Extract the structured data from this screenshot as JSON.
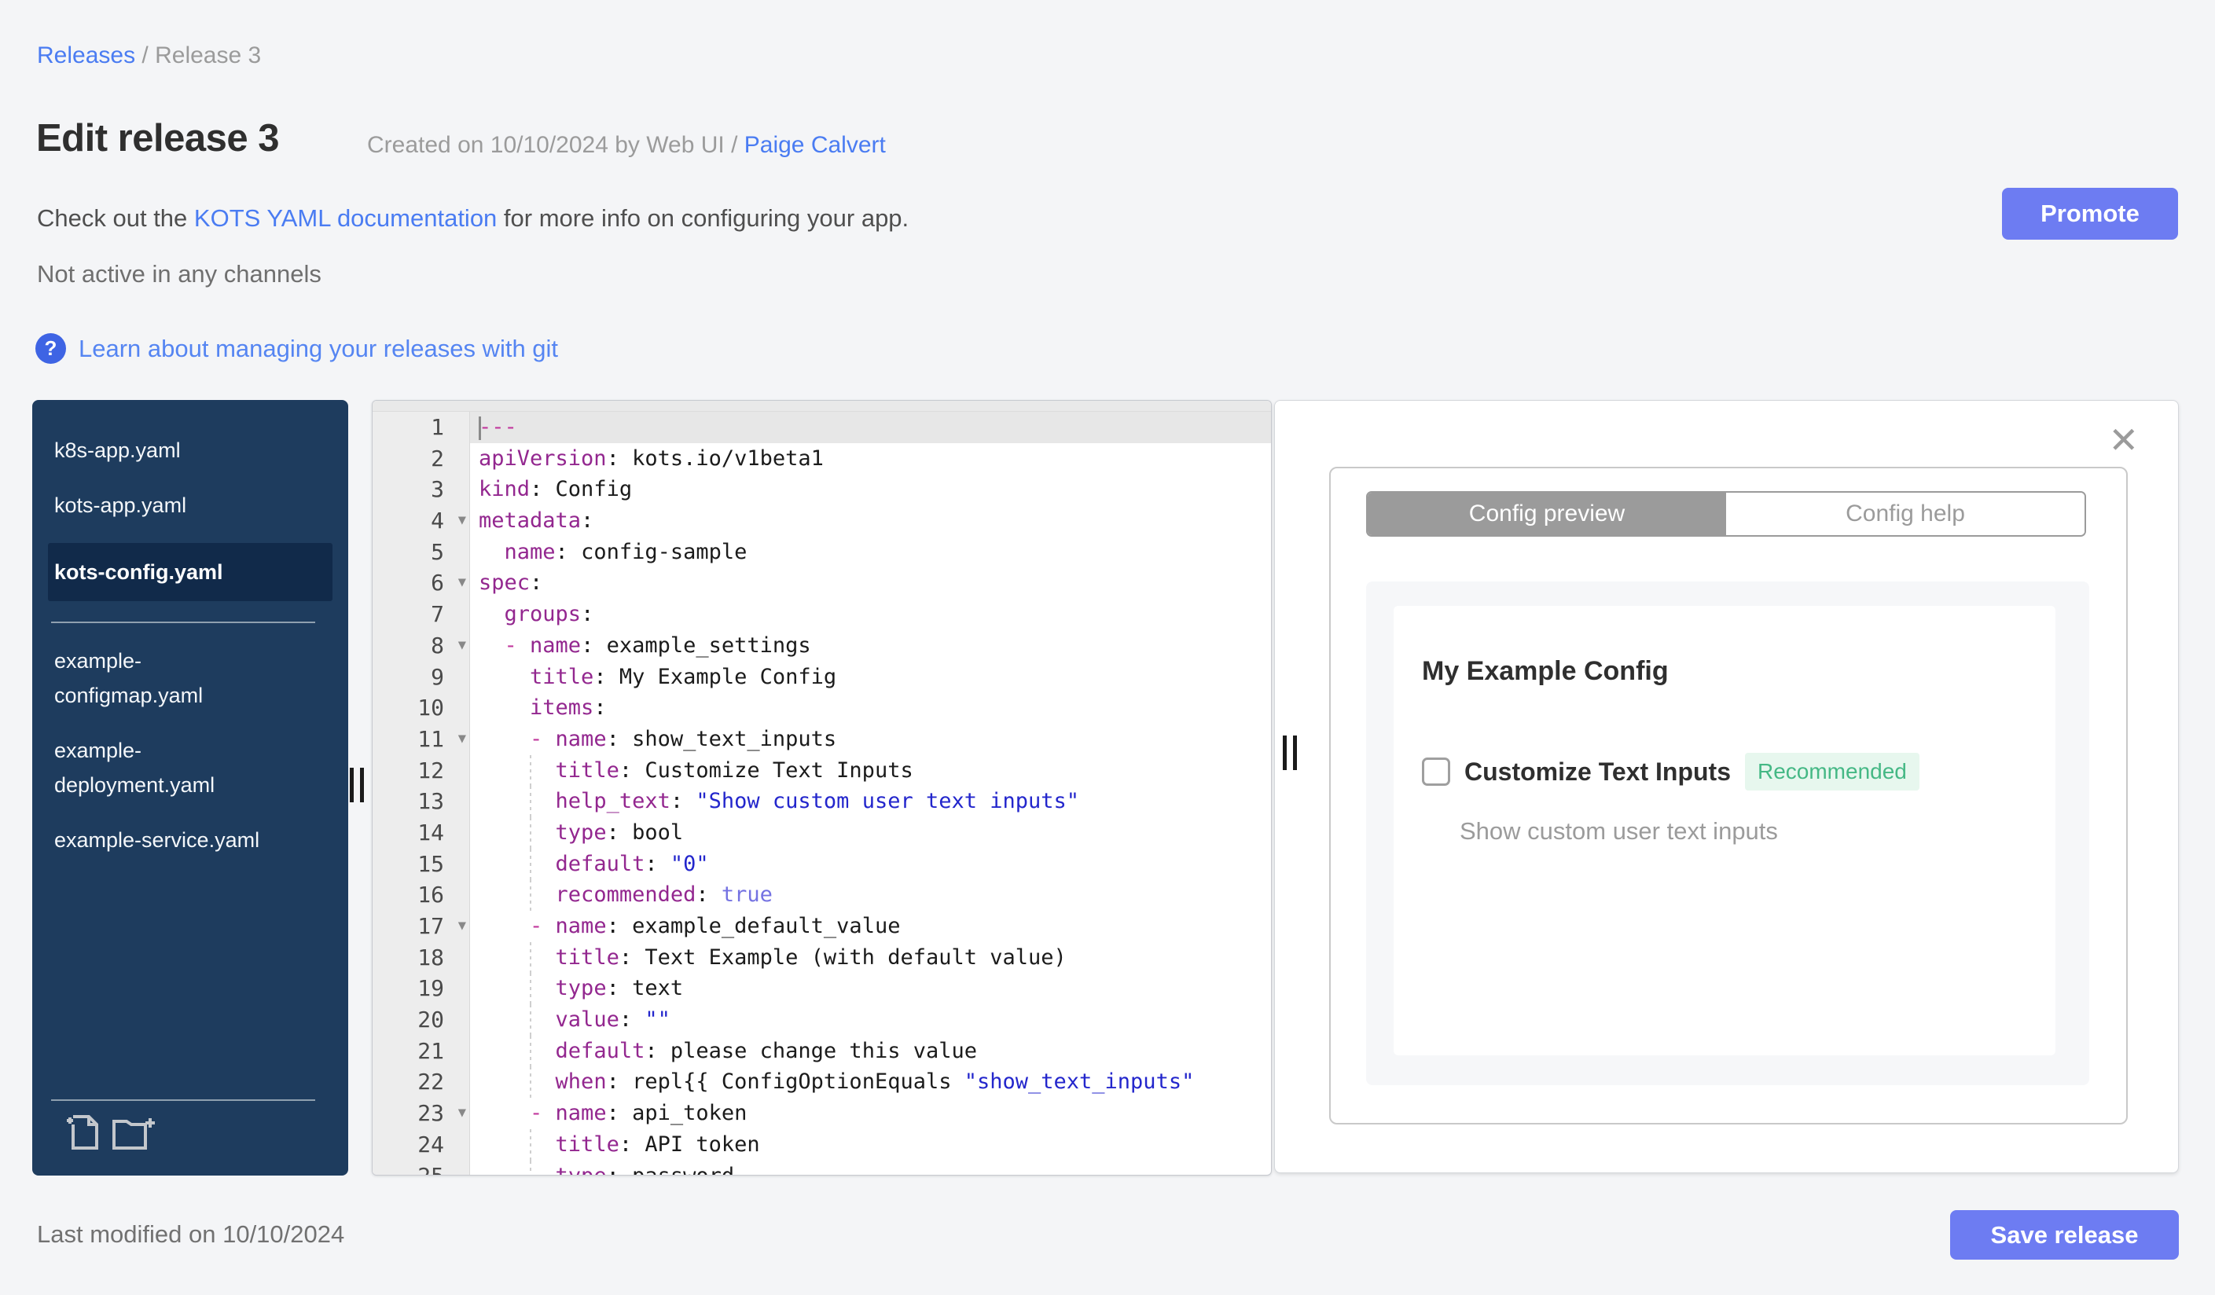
{
  "breadcrumb": {
    "link": "Releases",
    "separator": "/",
    "current": "Release 3"
  },
  "header": {
    "title": "Edit release 3",
    "created_prefix": "Created on 10/10/2024 by Web UI / ",
    "created_link": "Paige Calvert",
    "doc_prefix": "Check out the ",
    "doc_link": "KOTS YAML documentation",
    "doc_suffix": " for more info on configuring your app.",
    "channel_status": "Not active in any channels",
    "help_icon": "?",
    "help_link": "Learn about managing your releases with git"
  },
  "actions": {
    "promote": "Promote",
    "save": "Save release"
  },
  "footer": {
    "last_modified": "Last modified on 10/10/2024"
  },
  "file_tree": {
    "divider_after_index": 2,
    "files": [
      {
        "name": "k8s-app.yaml",
        "selected": false
      },
      {
        "name": "kots-app.yaml",
        "selected": false
      },
      {
        "name": "kots-config.yaml",
        "selected": true
      },
      {
        "name": "example-configmap.yaml",
        "selected": false
      },
      {
        "name": "example-deployment.yaml",
        "selected": false
      },
      {
        "name": "example-service.yaml",
        "selected": false
      }
    ],
    "icons": [
      "new-file-icon",
      "new-folder-icon"
    ]
  },
  "editor": {
    "active_line": 1,
    "fold_lines": [
      4,
      6,
      8,
      11,
      17,
      23
    ],
    "guide_lines": [
      12,
      13,
      14,
      15,
      16,
      18,
      19,
      20,
      21,
      22,
      24,
      25
    ],
    "lines": [
      {
        "t": [
          [
            "meta",
            "---"
          ]
        ]
      },
      {
        "t": [
          [
            "key",
            "apiVersion"
          ],
          [
            "plain",
            ": "
          ],
          [
            "val",
            "kots.io/v1beta1"
          ]
        ]
      },
      {
        "t": [
          [
            "key",
            "kind"
          ],
          [
            "plain",
            ": "
          ],
          [
            "val",
            "Config"
          ]
        ]
      },
      {
        "t": [
          [
            "key",
            "metadata"
          ],
          [
            "plain",
            ":"
          ]
        ]
      },
      {
        "t": [
          [
            "plain",
            "  "
          ],
          [
            "key",
            "name"
          ],
          [
            "plain",
            ": "
          ],
          [
            "val",
            "config-sample"
          ]
        ]
      },
      {
        "t": [
          [
            "key",
            "spec"
          ],
          [
            "plain",
            ":"
          ]
        ]
      },
      {
        "t": [
          [
            "plain",
            "  "
          ],
          [
            "key",
            "groups"
          ],
          [
            "plain",
            ":"
          ]
        ]
      },
      {
        "t": [
          [
            "plain",
            "  "
          ],
          [
            "meta",
            "- "
          ],
          [
            "key",
            "name"
          ],
          [
            "plain",
            ": "
          ],
          [
            "val",
            "example_settings"
          ]
        ]
      },
      {
        "t": [
          [
            "plain",
            "    "
          ],
          [
            "key",
            "title"
          ],
          [
            "plain",
            ": "
          ],
          [
            "val",
            "My Example Config"
          ]
        ]
      },
      {
        "t": [
          [
            "plain",
            "    "
          ],
          [
            "key",
            "items"
          ],
          [
            "plain",
            ":"
          ]
        ]
      },
      {
        "t": [
          [
            "plain",
            "    "
          ],
          [
            "meta",
            "- "
          ],
          [
            "key",
            "name"
          ],
          [
            "plain",
            ": "
          ],
          [
            "val",
            "show_text_inputs"
          ]
        ]
      },
      {
        "t": [
          [
            "plain",
            "      "
          ],
          [
            "key",
            "title"
          ],
          [
            "plain",
            ": "
          ],
          [
            "val",
            "Customize Text Inputs"
          ]
        ]
      },
      {
        "t": [
          [
            "plain",
            "      "
          ],
          [
            "key",
            "help_text"
          ],
          [
            "plain",
            ": "
          ],
          [
            "str",
            "\"Show custom user text inputs\""
          ]
        ]
      },
      {
        "t": [
          [
            "plain",
            "      "
          ],
          [
            "key",
            "type"
          ],
          [
            "plain",
            ": "
          ],
          [
            "val",
            "bool"
          ]
        ]
      },
      {
        "t": [
          [
            "plain",
            "      "
          ],
          [
            "key",
            "default"
          ],
          [
            "plain",
            ": "
          ],
          [
            "str",
            "\"0\""
          ]
        ]
      },
      {
        "t": [
          [
            "plain",
            "      "
          ],
          [
            "key",
            "recommended"
          ],
          [
            "plain",
            ": "
          ],
          [
            "atom",
            "true"
          ]
        ]
      },
      {
        "t": [
          [
            "plain",
            "    "
          ],
          [
            "meta",
            "- "
          ],
          [
            "key",
            "name"
          ],
          [
            "plain",
            ": "
          ],
          [
            "val",
            "example_default_value"
          ]
        ]
      },
      {
        "t": [
          [
            "plain",
            "      "
          ],
          [
            "key",
            "title"
          ],
          [
            "plain",
            ": "
          ],
          [
            "val",
            "Text Example (with default value)"
          ]
        ]
      },
      {
        "t": [
          [
            "plain",
            "      "
          ],
          [
            "key",
            "type"
          ],
          [
            "plain",
            ": "
          ],
          [
            "val",
            "text"
          ]
        ]
      },
      {
        "t": [
          [
            "plain",
            "      "
          ],
          [
            "key",
            "value"
          ],
          [
            "plain",
            ": "
          ],
          [
            "str",
            "\"\""
          ]
        ]
      },
      {
        "t": [
          [
            "plain",
            "      "
          ],
          [
            "key",
            "default"
          ],
          [
            "plain",
            ": "
          ],
          [
            "val",
            "please change this value"
          ]
        ]
      },
      {
        "t": [
          [
            "plain",
            "      "
          ],
          [
            "key",
            "when"
          ],
          [
            "plain",
            ": "
          ],
          [
            "val",
            "repl{{ ConfigOptionEquals "
          ],
          [
            "str",
            "\"show_text_inputs\""
          ]
        ]
      },
      {
        "t": [
          [
            "plain",
            "    "
          ],
          [
            "meta",
            "- "
          ],
          [
            "key",
            "name"
          ],
          [
            "plain",
            ": "
          ],
          [
            "val",
            "api_token"
          ]
        ]
      },
      {
        "t": [
          [
            "plain",
            "      "
          ],
          [
            "key",
            "title"
          ],
          [
            "plain",
            ": "
          ],
          [
            "val",
            "API token"
          ]
        ]
      },
      {
        "t": [
          [
            "plain",
            "      "
          ],
          [
            "key",
            "type"
          ],
          [
            "plain",
            ": "
          ],
          [
            "val",
            "password"
          ]
        ]
      }
    ]
  },
  "preview_panel": {
    "close_icon": "✕",
    "tabs": [
      {
        "label": "Config preview",
        "active": true
      },
      {
        "label": "Config help",
        "active": false
      }
    ],
    "config": {
      "group_title": "My Example Config",
      "item_label": "Customize Text Inputs",
      "badge": "Recommended",
      "help_text": "Show custom user text inputs",
      "checked": false
    }
  },
  "colors": {
    "accent_button": "#6d7cf2",
    "link_blue": "#4a7cf2",
    "sidebar_navy": "#1e3c5e",
    "sidebar_selected": "#112a4a",
    "badge_green": "#45b885",
    "badge_bg": "#e7f7ee",
    "tab_gray": "#9b9b9b"
  }
}
